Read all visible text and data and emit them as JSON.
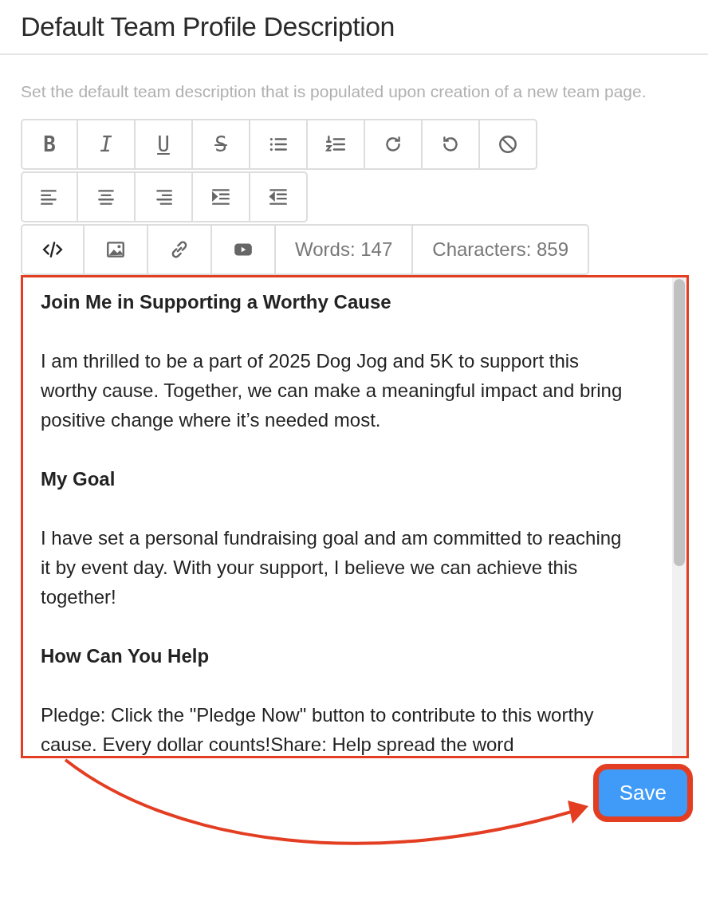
{
  "header": {
    "title": "Default Team Profile Description"
  },
  "description": "Set the default team description that is populated upon creation of a new team page.",
  "toolbar_rows": [
    [
      {
        "kind": "bold",
        "glyph": "B"
      },
      {
        "kind": "italic",
        "glyph": "I"
      },
      {
        "kind": "underline",
        "glyph": "U"
      },
      {
        "kind": "strike",
        "glyph": "S"
      },
      {
        "kind": "bullets"
      },
      {
        "kind": "numbers"
      },
      {
        "kind": "redo"
      },
      {
        "kind": "undo"
      },
      {
        "kind": "clear"
      }
    ],
    [
      {
        "kind": "align-left"
      },
      {
        "kind": "align-center"
      },
      {
        "kind": "align-right"
      },
      {
        "kind": "indent"
      },
      {
        "kind": "outdent"
      }
    ],
    [
      {
        "kind": "code"
      },
      {
        "kind": "image"
      },
      {
        "kind": "link"
      },
      {
        "kind": "video"
      },
      {
        "kind": "counter",
        "text": "Words: 147"
      },
      {
        "kind": "counter",
        "text": "Characters: 859"
      }
    ]
  ],
  "editor": {
    "highlighted": true,
    "blocks": [
      {
        "kind": "heading",
        "text": "Join Me in Supporting a Worthy Cause"
      },
      {
        "kind": "paragraph",
        "text": "I am thrilled to be a part of 2025 Dog Jog and 5K to support this worthy cause. Together, we can make a meaningful impact and bring positive change where it’s needed most."
      },
      {
        "kind": "heading",
        "text": "My Goal"
      },
      {
        "kind": "paragraph",
        "text": "I have set a personal fundraising goal and am committed to reaching it by event day. With your support, I believe we can achieve this together!"
      },
      {
        "kind": "heading",
        "text": "How Can You Help"
      },
      {
        "kind": "paragraph",
        "text": "Pledge: Click the \"Pledge Now\" button to contribute to this worthy cause. Every dollar counts!Share: Help spread the word"
      }
    ]
  },
  "save_button": {
    "label": "Save",
    "highlighted": true
  },
  "annotation": {
    "arrow": true
  }
}
